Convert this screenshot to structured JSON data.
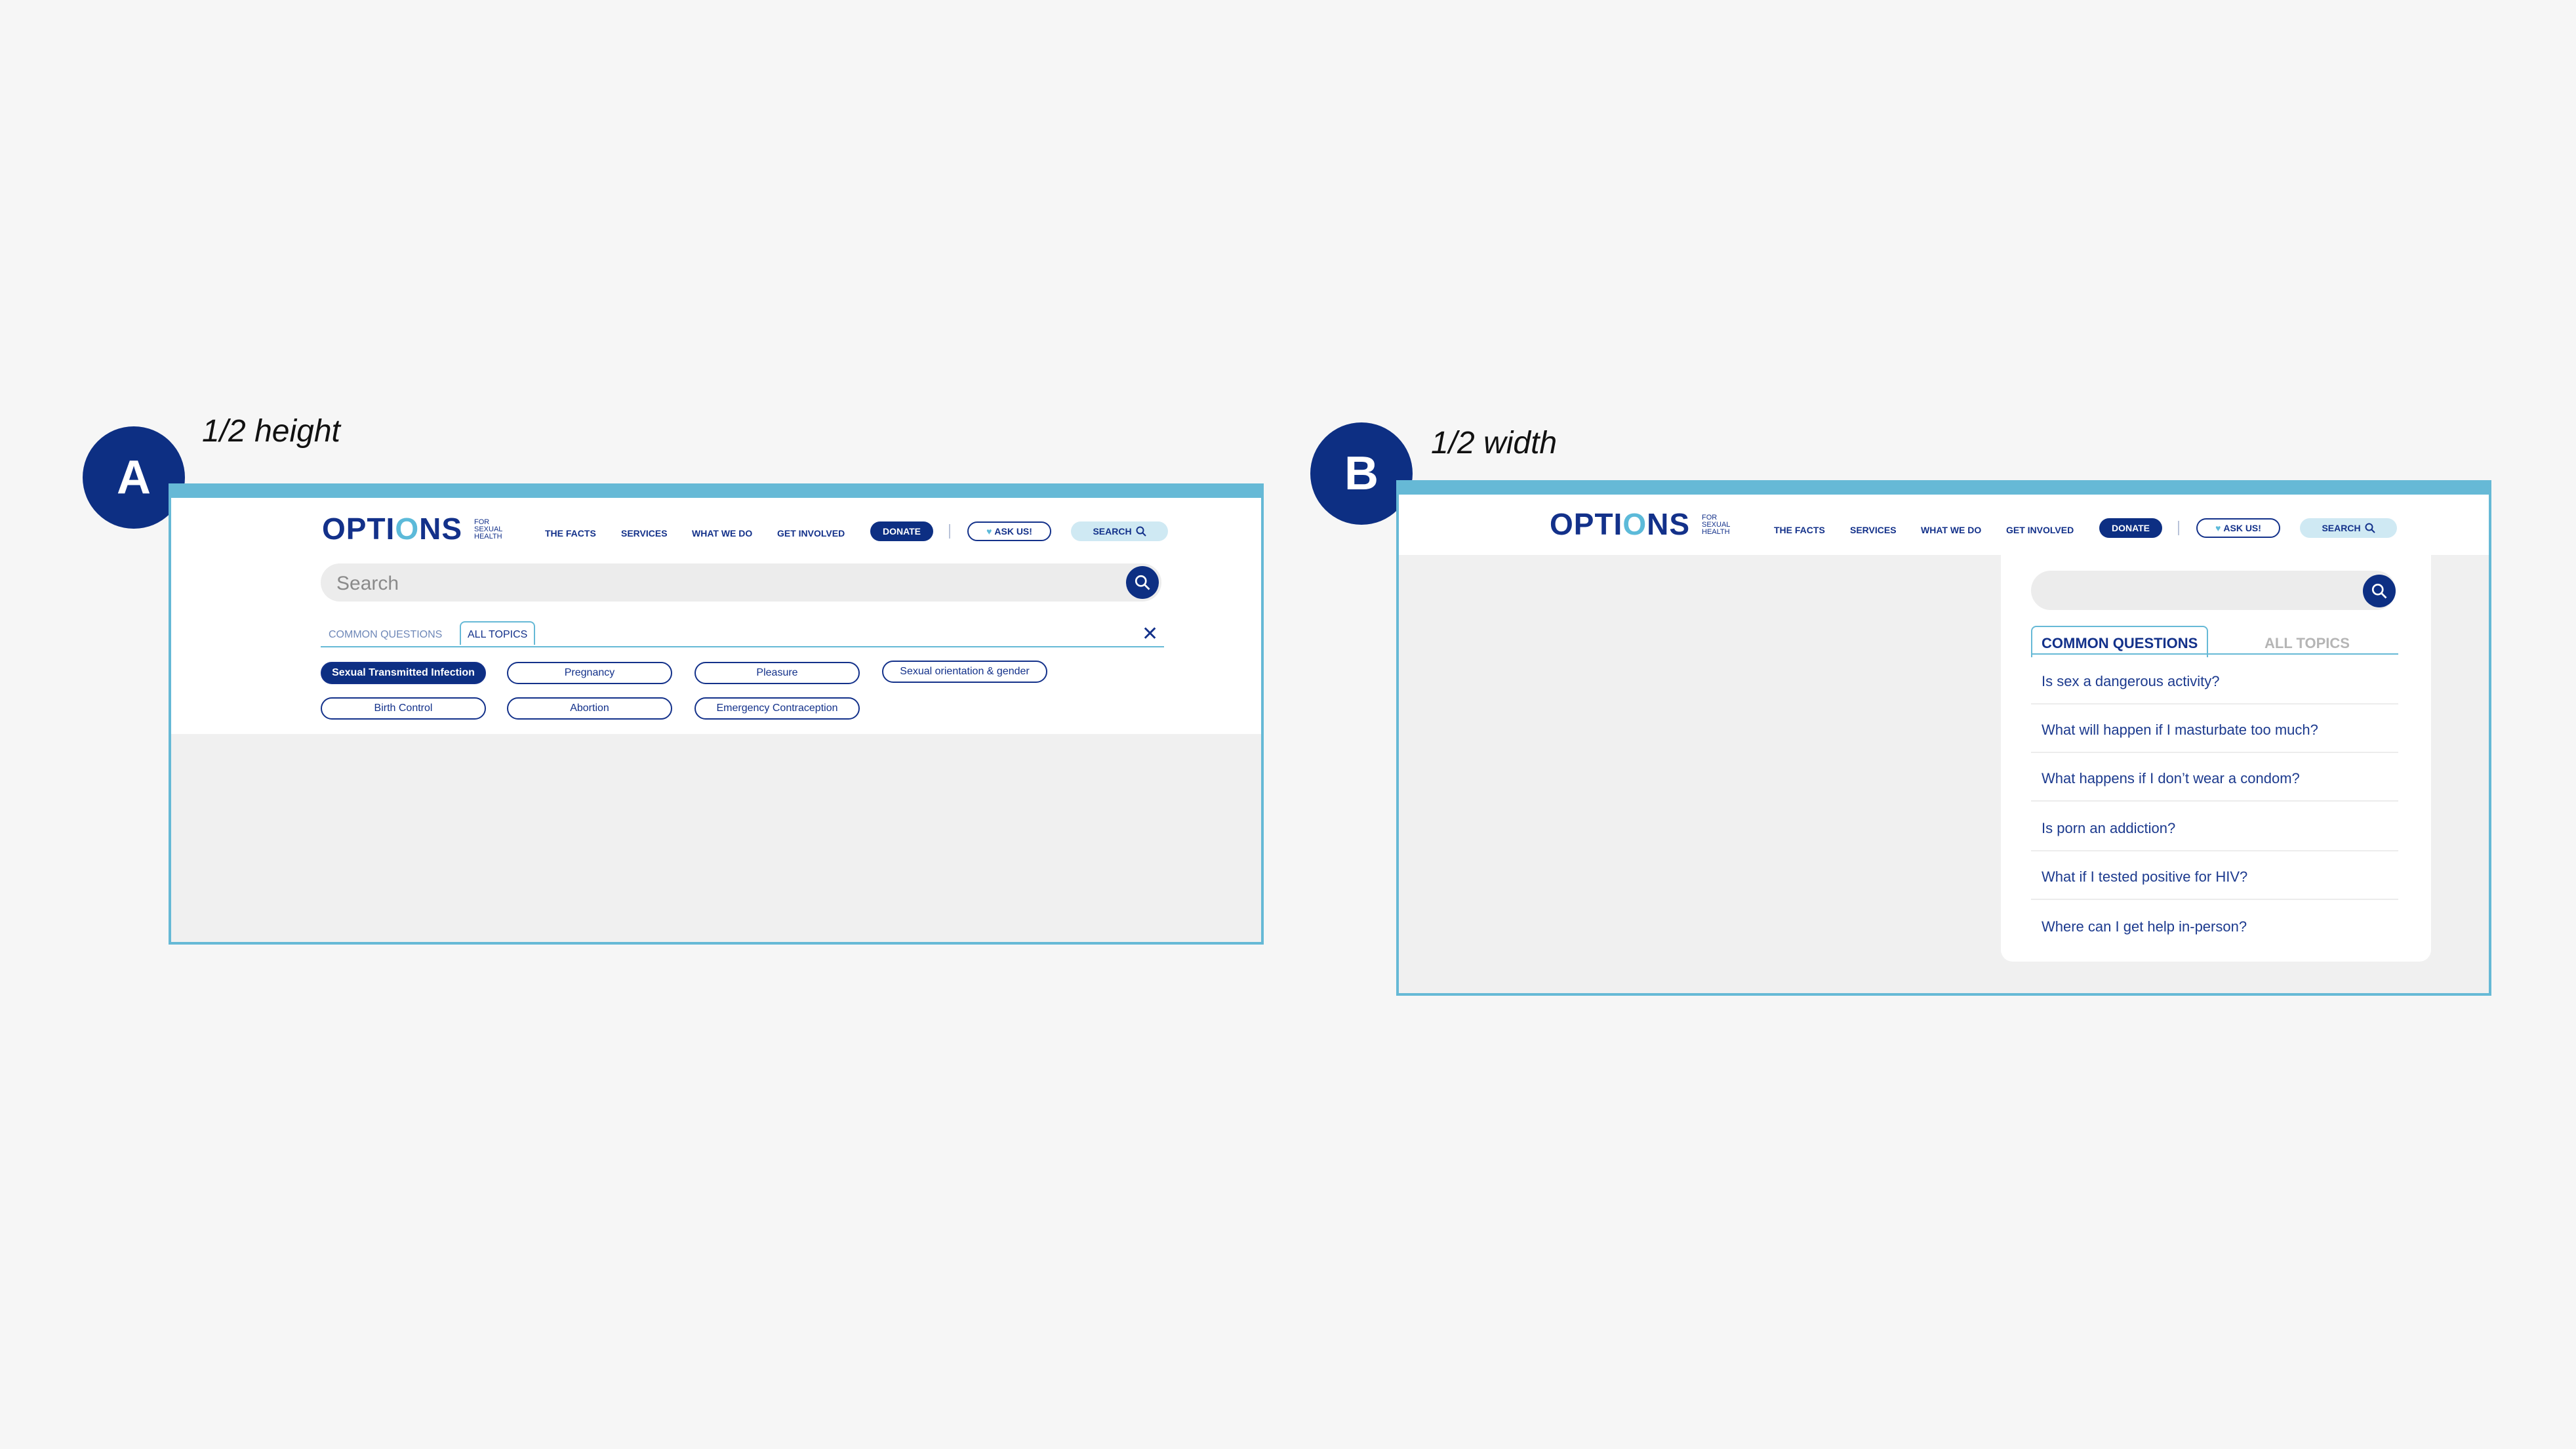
{
  "panels": [
    {
      "badge": "A",
      "caption": "1/2 height"
    },
    {
      "badge": "B",
      "caption": "1/2 width"
    }
  ],
  "header": {
    "logo": "OPTIONS",
    "logo_sub": [
      "FOR",
      "SEXUAL",
      "HEALTH"
    ],
    "nav": [
      "THE FACTS",
      "SERVICES",
      "WHAT WE DO",
      "GET INVOLVED"
    ],
    "donate": "DONATE",
    "ask_us": "ASK US!",
    "search": "SEARCH"
  },
  "panel_a": {
    "search_placeholder": "Search",
    "tabs": [
      "COMMON QUESTIONS",
      "ALL TOPICS"
    ],
    "active_tab": "ALL TOPICS",
    "topics": [
      "Sexual Transmitted Infection",
      "Pregnancy",
      "Pleasure",
      "Sexual orientation & gender",
      "Birth Control",
      "Abortion",
      "Emergency Contraception"
    ],
    "selected_topic": "Sexual Transmitted Infection"
  },
  "panel_b": {
    "search_placeholder": "",
    "tabs": [
      "COMMON QUESTIONS",
      "ALL TOPICS"
    ],
    "active_tab": "COMMON QUESTIONS",
    "questions": [
      "Is sex a dangerous activity?",
      "What will happen if I masturbate too much?",
      "What happens if I don’t wear a condom?",
      "Is porn an addiction?",
      "What if I tested positive for HIV?",
      "Where can I get help in-person?"
    ]
  },
  "colors": {
    "brand_navy": "#0d2f83",
    "accent_blue": "#66b9d6",
    "search_pill": "#cfe9f3"
  }
}
